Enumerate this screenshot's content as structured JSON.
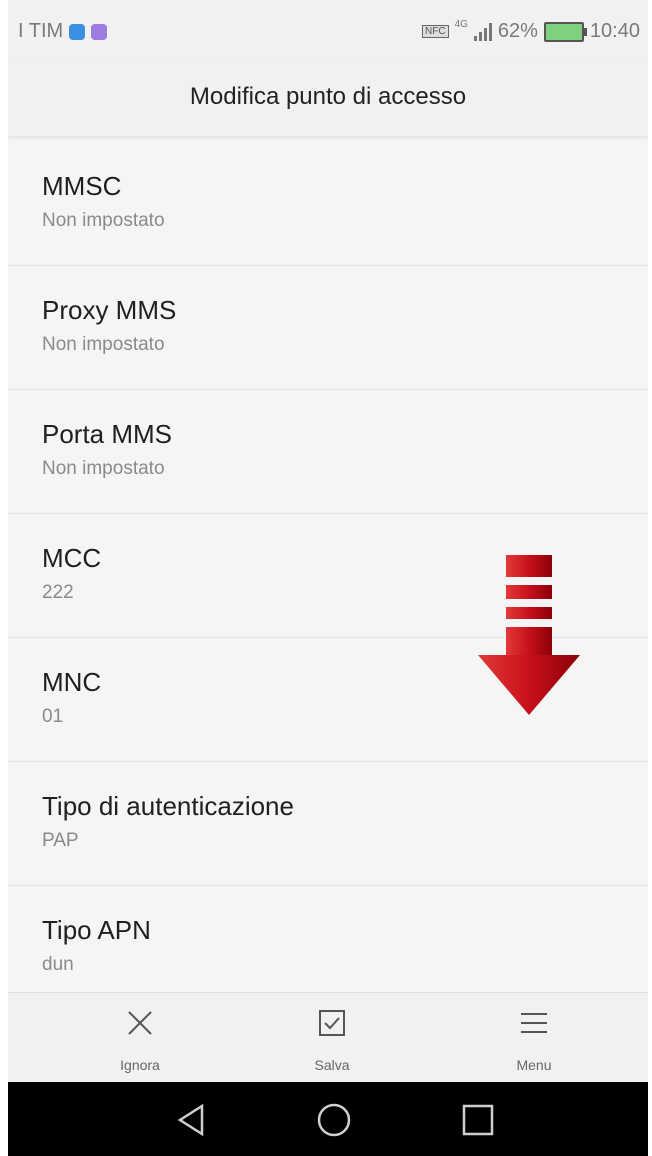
{
  "status_bar": {
    "carrier": "I TIM",
    "nfc": "NFC",
    "network": "4G",
    "battery": "62%",
    "time": "10:40"
  },
  "header": {
    "title": "Modifica punto di accesso"
  },
  "settings": [
    {
      "title": "MMSC",
      "value": "Non impostato"
    },
    {
      "title": "Proxy MMS",
      "value": "Non impostato"
    },
    {
      "title": "Porta MMS",
      "value": "Non impostato"
    },
    {
      "title": "MCC",
      "value": "222"
    },
    {
      "title": "MNC",
      "value": "01"
    },
    {
      "title": "Tipo di autenticazione",
      "value": "PAP"
    },
    {
      "title": "Tipo APN",
      "value": "dun"
    }
  ],
  "bottom_bar": {
    "ignore_label": "Ignora",
    "save_label": "Salva",
    "menu_label": "Menu"
  },
  "icons": {
    "close": "close-icon",
    "save": "checkbox-icon",
    "menu": "hamburger-icon",
    "back": "back-triangle-icon",
    "home": "home-circle-icon",
    "recent": "recent-square-icon",
    "overlay": "down-arrow-icon"
  },
  "colors": {
    "arrow": "#c8101a",
    "background": "#f5f5f5"
  }
}
